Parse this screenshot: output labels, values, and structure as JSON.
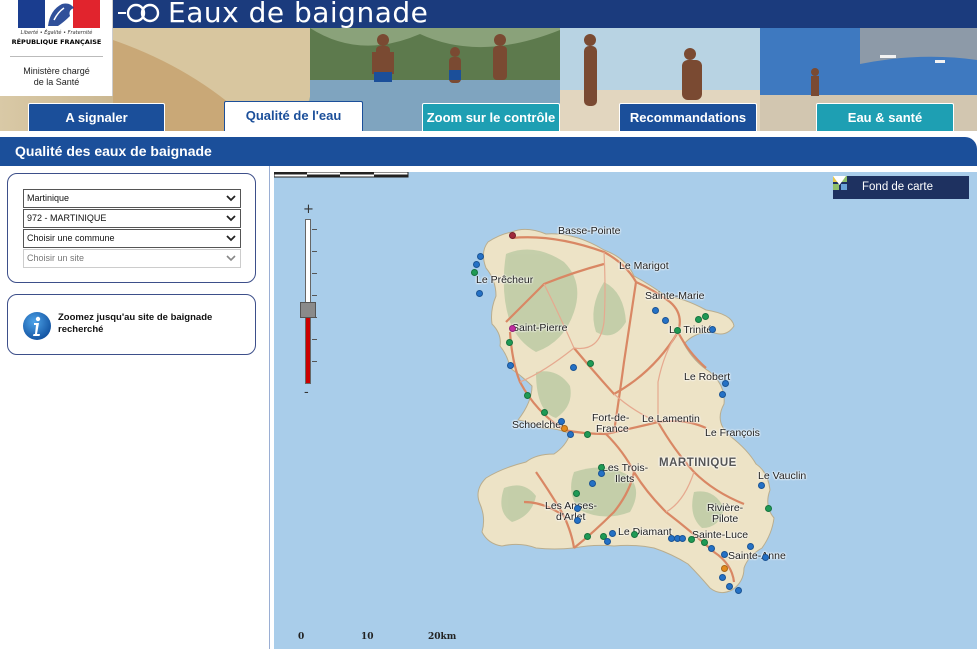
{
  "header": {
    "site_title": "Eaux de baignade",
    "rf_motto": "Liberté • Égalité • Fraternité",
    "rf_name": "RÉPUBLIQUE FRANÇAISE",
    "ministry_line1": "Ministère chargé",
    "ministry_line2": "de la Santé"
  },
  "tabs": [
    {
      "label": "A signaler",
      "active": false
    },
    {
      "label": "Qualité de l'eau",
      "active": true
    },
    {
      "label": "Zoom sur le contrôle",
      "active": false
    },
    {
      "label": "Recommandations",
      "active": false
    },
    {
      "label": "Eau & santé",
      "active": false
    }
  ],
  "section": {
    "title": "Qualité des eaux de baignade"
  },
  "filters": {
    "region": "Martinique",
    "department": "972 - MARTINIQUE",
    "commune_placeholder": "Choisir une commune",
    "site_placeholder": "Choisir un site"
  },
  "hint": {
    "text": "Zoomez jusqu'au site de baignade recherché"
  },
  "map": {
    "basemap_label": "Fond de carte",
    "zoom_plus": "+",
    "zoom_minus": "-",
    "zoom_level_fraction": 0.45,
    "island_label": "MARTINIQUE",
    "towns": {
      "basse_pointe": "Basse-Pointe",
      "le_marigot": "Le Marigot",
      "le_precheur": "Le Prêcheur",
      "sainte_marie": "Sainte-Marie",
      "saint_pierre": "Saint-Pierre",
      "la_trinite": "La Trinité",
      "le_robert": "Le Robert",
      "schoelcher": "Schoelcher",
      "fort_de_france_1": "Fort-de-",
      "fort_de_france_2": "France",
      "le_lamentin": "Le Lamentin",
      "le_francois": "Le François",
      "les_trois_ilets_1": "Les Trois-",
      "les_trois_ilets_2": "Ilets",
      "le_vauclin": "Le Vauclin",
      "les_anses_1": "Les Anses-",
      "les_anses_2": "d'Arlet",
      "riviere_pilote_1": "Rivière-",
      "riviere_pilote_2": "Pilote",
      "le_diamant": "Le Diamant",
      "sainte_luce": "Sainte-Luce",
      "sainte_anne": "Sainte-Anne"
    },
    "scale": {
      "labels": [
        "0",
        "10",
        "20km"
      ]
    },
    "colors": {
      "sea": "#a9cdea",
      "land": "#ede3c6",
      "site_excellent": "#2471c6",
      "site_good": "#1f9a55",
      "site_sufficient": "#e38a1c",
      "site_poor": "#a0283a",
      "site_other": "#c02fa0"
    }
  }
}
